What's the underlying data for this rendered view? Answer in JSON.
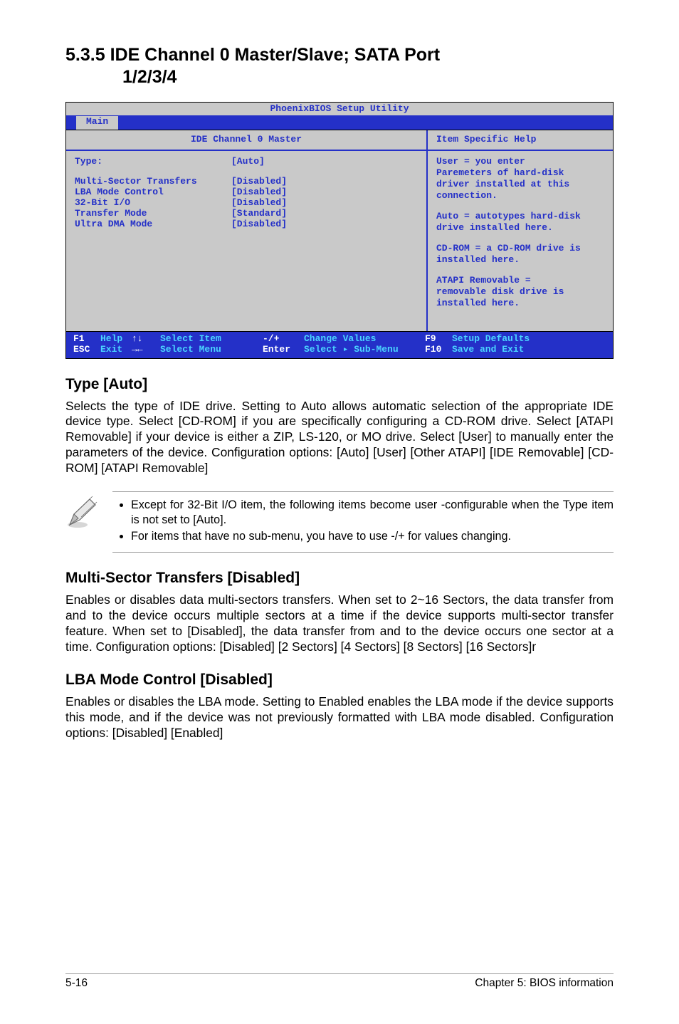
{
  "section": {
    "number": "5.3.5",
    "title_line1": "IDE Channel 0 Master/Slave; SATA Port",
    "title_line2": "1/2/3/4"
  },
  "bios": {
    "header": "PhoenixBIOS Setup Utility",
    "tab": "Main",
    "left_panel_title": "IDE Channel 0 Master",
    "right_panel_title": "Item Specific Help",
    "rows": {
      "type_label": "Type:",
      "type_value": "[Auto]",
      "mst_label": "Multi-Sector Transfers",
      "mst_value": "[Disabled]",
      "lba_label": "LBA Mode Control",
      "lba_value": "[Disabled]",
      "io_label": "32-Bit I/O",
      "io_value": "[Disabled]",
      "tm_label": "Transfer Mode",
      "tm_value": "[Standard]",
      "udma_label": "Ultra DMA Mode",
      "udma_value": "[Disabled]"
    },
    "help": {
      "l1": "User = you enter",
      "l2": "Paremeters of hard-disk",
      "l3": "driver installed at this",
      "l4": "connection.",
      "l5": "Auto = autotypes hard-disk",
      "l6": "drive installed here.",
      "l7": "CD-ROM = a CD-ROM drive is",
      "l8": "installed here.",
      "l9": "ATAPI Removable =",
      "l10": "removable disk drive is",
      "l11": "installed here."
    },
    "footer": {
      "f1_key": "F1",
      "f1_act": "Help",
      "updown_key": "↑↓",
      "updown_act": "Select Item",
      "pm_key": "-/+",
      "pm_act": "Change Values",
      "f9_key": "F9",
      "f9_act": "Setup Defaults",
      "esc_key": "ESC",
      "esc_act": "Exit",
      "lr_key": "→←",
      "lr_act": "Select Menu",
      "enter_key": "Enter",
      "enter_act": "Select ▸ Sub-Menu",
      "f10_key": "F10",
      "f10_act": "Save and Exit"
    }
  },
  "typeauto": {
    "heading": "Type [Auto]",
    "body": "Selects the type of IDE drive. Setting to Auto allows automatic selection of the appropriate IDE device type. Select [CD-ROM] if you are specifically configuring a CD-ROM drive. Select [ATAPI Removable] if your device is either a ZIP, LS-120, or MO drive. Select [User] to manually enter the parameters of the device. Configuration options: [Auto] [User] [Other ATAPI] [IDE Removable] [CD-ROM] [ATAPI Removable]"
  },
  "note": {
    "b1": "Except for 32-Bit I/O item, the following items become user -configurable when the Type item is not set to [Auto].",
    "b2": "For items that have no sub-menu, you have to use -/+ for values changing."
  },
  "multisector": {
    "heading": "Multi-Sector Transfers [Disabled]",
    "body": "Enables or disables data multi-sectors transfers. When set to 2~16 Sectors, the data transfer from and to the device occurs multiple sectors at a time if the device supports multi-sector transfer feature. When set to [Disabled], the data transfer from and to the device occurs one sector at a time. Configuration options: [Disabled] [2 Sectors] [4 Sectors] [8 Sectors] [16 Sectors]r"
  },
  "lba": {
    "heading": "LBA Mode Control [Disabled]",
    "body": "Enables or disables the LBA mode. Setting to Enabled enables the LBA mode if the device supports this mode, and if the device was not previously formatted with LBA mode disabled. Configuration options: [Disabled] [Enabled]"
  },
  "footer": {
    "page": "5-16",
    "chapter": "Chapter 5: BIOS information"
  }
}
